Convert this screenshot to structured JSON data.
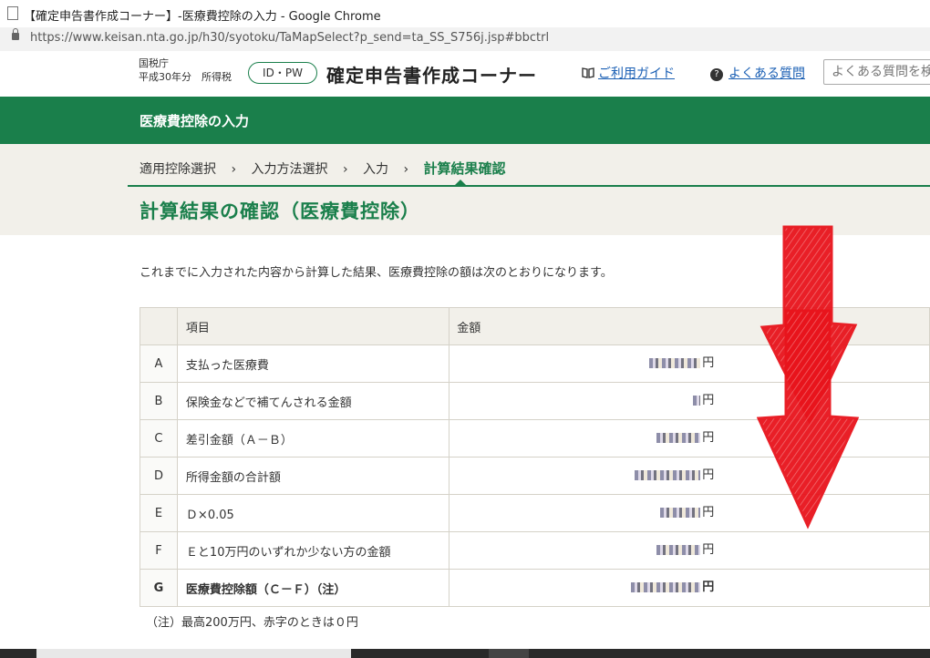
{
  "window": {
    "title": "【確定申告書作成コーナー】-医療費控除の入力 - Google Chrome",
    "url": "https://www.keisan.nta.go.jp/h30/syotoku/TaMapSelect?p_send=ta_SS_S756j.jsp#bbctrl"
  },
  "header": {
    "agency": "国税庁",
    "year_type": "平成30年分　所得税",
    "idpw": "ID・PW",
    "corner_title": "確定申告書作成コーナー",
    "guide_label": "ご利用ガイド",
    "faq_label": "よくある質問",
    "faq_search_placeholder": "よくある質問を検"
  },
  "band": {
    "title": "医療費控除の入力"
  },
  "breadcrumb": {
    "steps": [
      "適用控除選択",
      "入力方法選択",
      "入力",
      "計算結果確認"
    ],
    "separator": "›"
  },
  "page_title": "計算結果の確認（医療費控除）",
  "intro": "これまでに入力された内容から計算した結果、医療費控除の額は次のとおりになります。",
  "table": {
    "headers": {
      "item": "項目",
      "amount": "金額"
    },
    "rows": [
      {
        "key": "A",
        "item": "支払った医療費",
        "unit": "円"
      },
      {
        "key": "B",
        "item": "保険金などで補てんされる金額",
        "unit": "円"
      },
      {
        "key": "C",
        "item": "差引金額（Ａ－Ｂ）",
        "unit": "円"
      },
      {
        "key": "D",
        "item": "所得金額の合計額",
        "unit": "円"
      },
      {
        "key": "E",
        "item": "Ｄ×0.05",
        "unit": "円"
      },
      {
        "key": "F",
        "item": "Ｅと10万円のいずれか少ない方の金額",
        "unit": "円"
      },
      {
        "key": "G",
        "item": "医療費控除額（Ｃ－Ｆ）（注）",
        "unit": "円"
      }
    ]
  },
  "note": "（注）最高200万円、赤字のときは０円",
  "colors": {
    "brand_green": "#1a7f4b",
    "beige": "#f2f0ea",
    "link_blue": "#1a5fb4",
    "annotation_red": "#e8141c"
  }
}
